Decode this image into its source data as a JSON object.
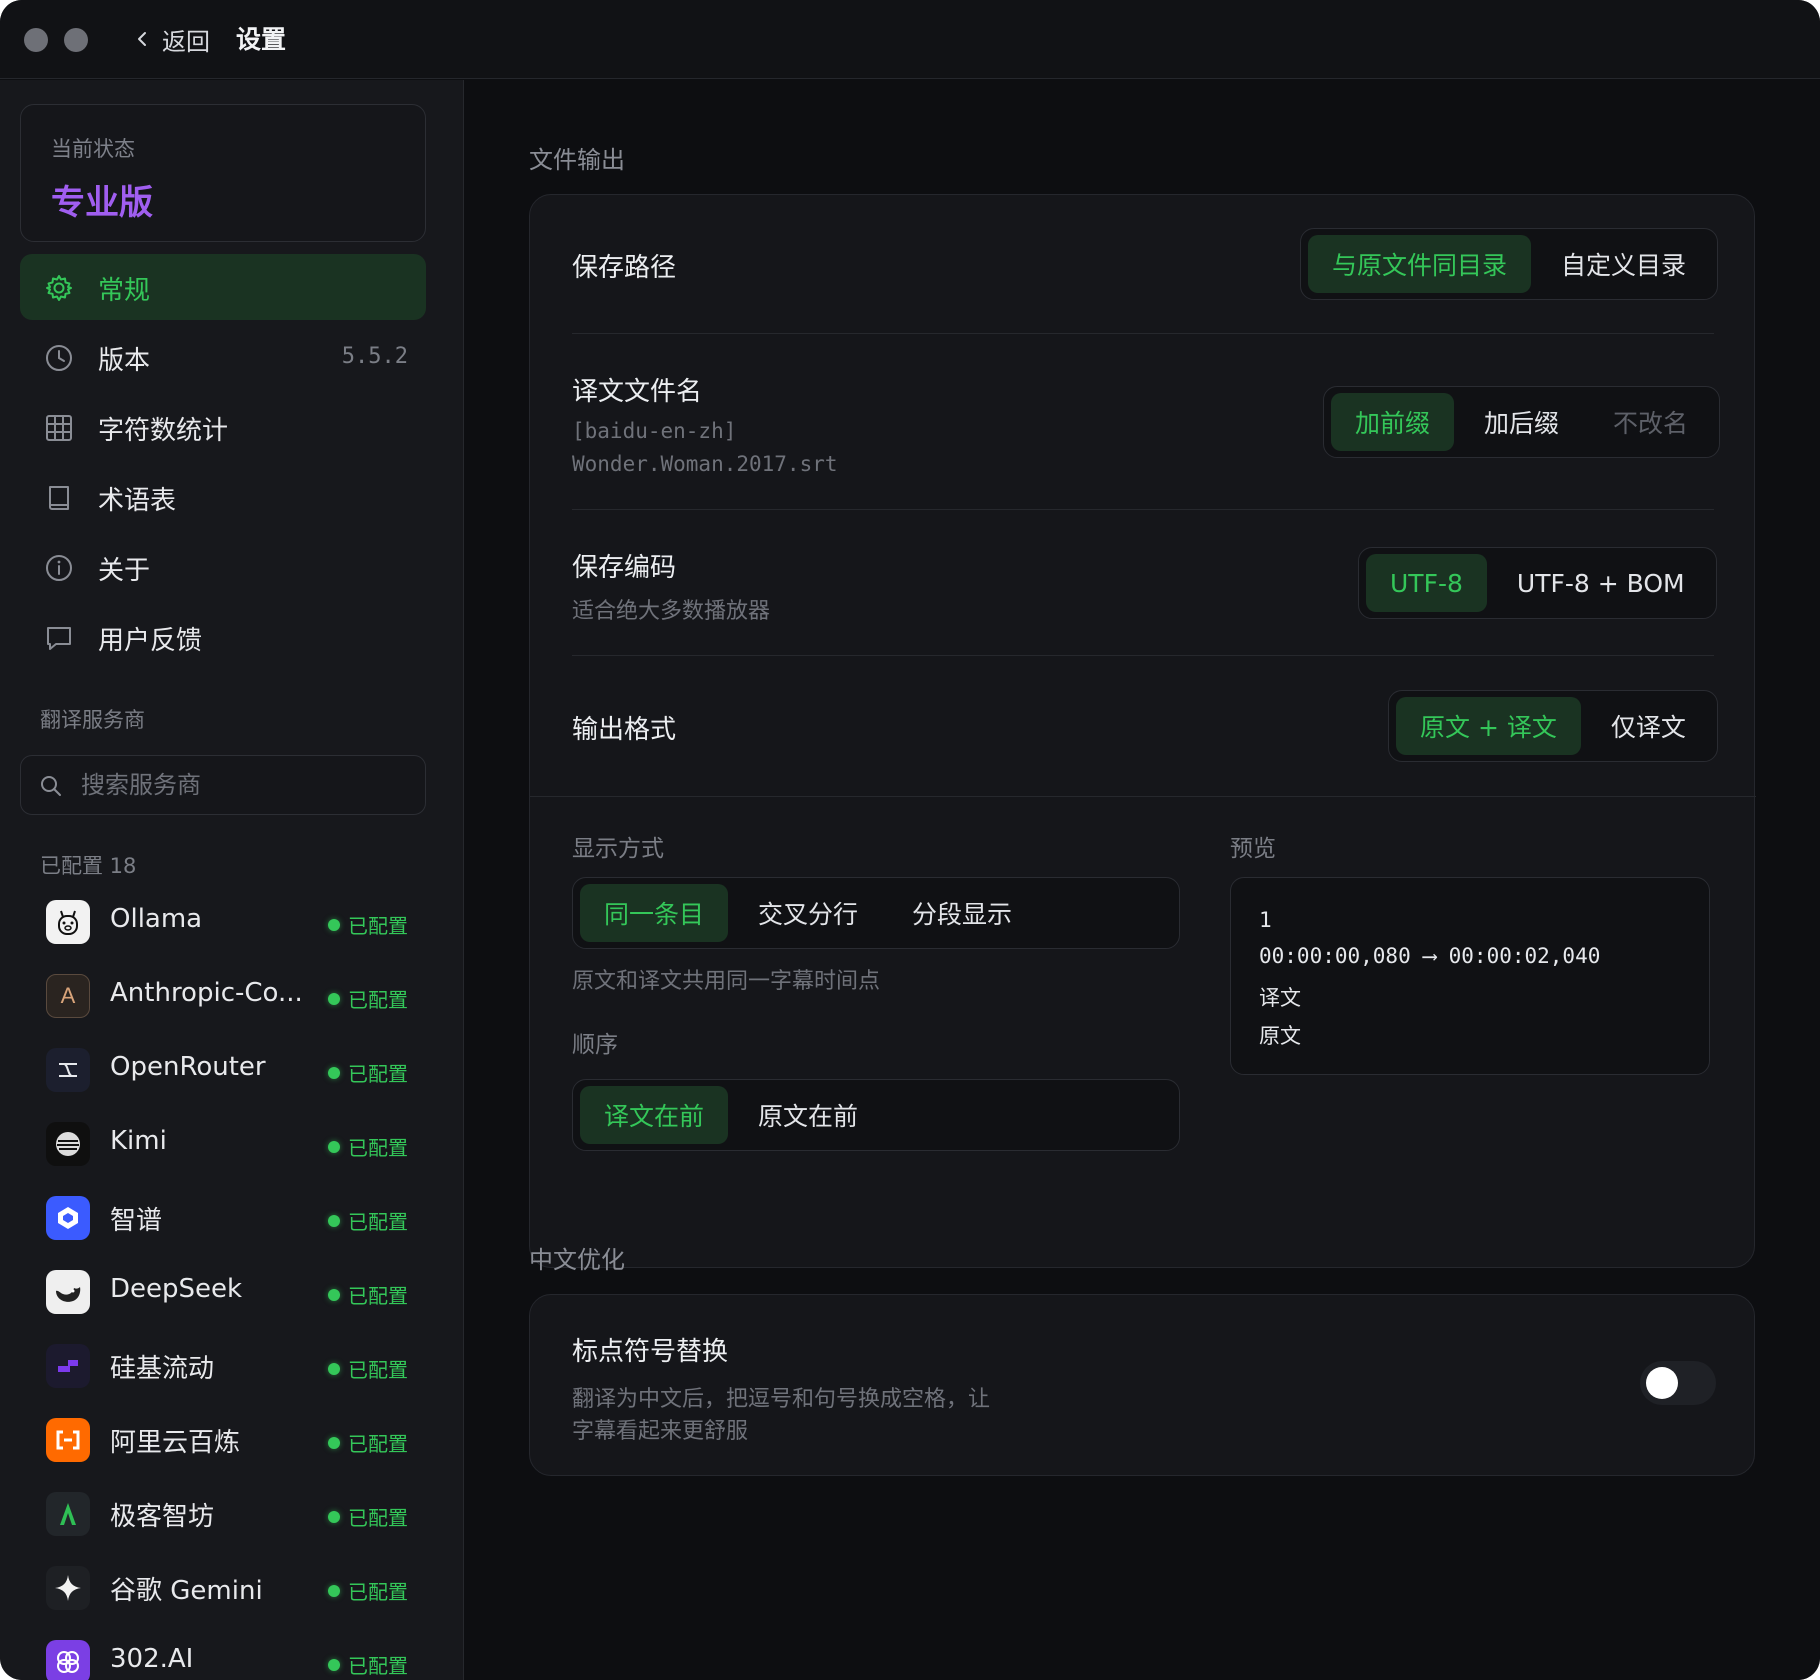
{
  "titlebar": {
    "back_label": "返回",
    "title": "设置"
  },
  "sidebar": {
    "status_label": "当前状态",
    "status_value": "专业版",
    "nav": [
      {
        "label": "常规",
        "icon": "gear-icon",
        "active": true
      },
      {
        "label": "版本",
        "icon": "clock-icon",
        "value": "5.5.2"
      },
      {
        "label": "字符数统计",
        "icon": "grid-icon"
      },
      {
        "label": "术语表",
        "icon": "book-icon"
      },
      {
        "label": "关于",
        "icon": "info-icon"
      },
      {
        "label": "用户反馈",
        "icon": "chat-icon"
      }
    ],
    "providers_heading": "翻译服务商",
    "search_placeholder": "搜索服务商",
    "configured_heading": "已配置 18",
    "providers": [
      {
        "name": "Ollama",
        "icon": "ollama-icon",
        "status": "已配置"
      },
      {
        "name": "Anthropic-Co...",
        "icon": "anthropic-icon",
        "status": "已配置"
      },
      {
        "name": "OpenRouter",
        "icon": "openrouter-icon",
        "status": "已配置"
      },
      {
        "name": "Kimi",
        "icon": "kimi-icon",
        "status": "已配置"
      },
      {
        "name": "智谱",
        "icon": "zhipu-icon",
        "status": "已配置"
      },
      {
        "name": "DeepSeek",
        "icon": "deepseek-icon",
        "status": "已配置"
      },
      {
        "name": "硅基流动",
        "icon": "siliconflow-icon",
        "status": "已配置"
      },
      {
        "name": "阿里云百炼",
        "icon": "aliyun-icon",
        "status": "已配置"
      },
      {
        "name": "极客智坊",
        "icon": "geek-icon",
        "status": "已配置"
      },
      {
        "name": "谷歌 Gemini",
        "icon": "gemini-icon",
        "status": "已配置"
      },
      {
        "name": "302.AI",
        "icon": "302ai-icon",
        "status": "已配置"
      }
    ]
  },
  "file_output": {
    "title": "文件输出",
    "save_path": {
      "label": "保存路径",
      "options": [
        "与原文件同目录",
        "自定义目录"
      ],
      "selected": 0
    },
    "filename": {
      "label": "译文文件名",
      "example_line1": "[baidu-en-zh]",
      "example_line2": "Wonder.Woman.2017.srt",
      "options": [
        "加前缀",
        "加后缀",
        "不改名"
      ],
      "selected": 0
    },
    "encoding": {
      "label": "保存编码",
      "hint": "适合绝大多数播放器",
      "options": [
        "UTF-8",
        "UTF-8 + BOM"
      ],
      "selected": 0
    },
    "format": {
      "label": "输出格式",
      "options": [
        "原文 + 译文",
        "仅译文"
      ],
      "selected": 0
    },
    "display": {
      "label": "显示方式",
      "options": [
        "同一条目",
        "交叉分行",
        "分段显示"
      ],
      "selected": 0,
      "hint": "原文和译文共用同一字幕时间点"
    },
    "order": {
      "label": "顺序",
      "options": [
        "译文在前",
        "原文在前"
      ],
      "selected": 0
    },
    "preview": {
      "label": "预览",
      "index": "1",
      "timecode": "00:00:00,080 ⟶ 00:00:02,040",
      "line1": "译文",
      "line2": "原文"
    }
  },
  "chinese": {
    "title": "中文优化",
    "punct": {
      "label": "标点符号替换",
      "hint_line1": "翻译为中文后，把逗号和句号换成空格，让",
      "hint_line2": "字幕看起来更舒服",
      "enabled": false
    }
  },
  "colors": {
    "accent": "#34c759",
    "selected_bg": "#1a3322",
    "pro": "#a05ef0"
  }
}
